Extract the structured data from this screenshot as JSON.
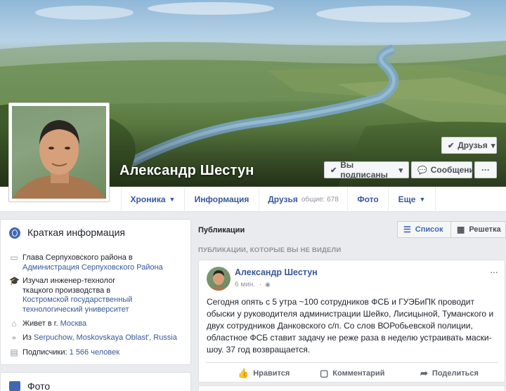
{
  "profile": {
    "name": "Александр Шестун",
    "buttons": {
      "friends": "Друзья",
      "subscribed": "Вы подписаны",
      "message": "Сообщение",
      "more": "···"
    }
  },
  "nav": {
    "tabs": [
      {
        "label": "Хроника",
        "caret": "▼"
      },
      {
        "label": "Информация"
      },
      {
        "label": "Друзья",
        "sub": "общие: 678"
      },
      {
        "label": "Фото"
      },
      {
        "label": "Еще",
        "caret": "▼"
      }
    ]
  },
  "intro": {
    "title": "Краткая информация",
    "rows": [
      {
        "icon": "briefcase-icon",
        "text": "Глава Серпуховского района в",
        "link": "Администрация Серпуховского Района"
      },
      {
        "icon": "graduation-cap-icon",
        "text": "Изучал инженер-технолог ткацкого производства в",
        "link": "Костромской государственный технологический университет"
      },
      {
        "icon": "home-icon",
        "text": "Живет в г.",
        "link": "Москва"
      },
      {
        "icon": "location-pin-icon",
        "text": "Из",
        "link": "Serpuchow, Moskovskaya Oblast', Russia"
      },
      {
        "icon": "subscribers-icon",
        "text": "Подписчики:",
        "link": "1 566 человек"
      }
    ]
  },
  "photos": {
    "title": "Фото"
  },
  "publications": {
    "title": "Публикации",
    "list_view": "Список",
    "grid_view": "Решетка",
    "unseen_label": "ПУБЛИКАЦИИ, КОТОРЫЕ ВЫ НЕ ВИДЕЛИ"
  },
  "post": {
    "author": "Александр Шестун",
    "time": "6 мин.",
    "text": "Сегодня опять с 5 утра ~100 сотрудников ФСБ и ГУЭБиПК проводит обыски у руководителя администрации Шейко, Лисицыной, Туманского и двух сотрудников Данковского с/п. Со слов ВОРобьевской полиции, областное ФСБ ставит задачу не реже раза в неделю устраивать маски-шоу. 37 год возвращается.",
    "actions": {
      "like": "Нравится",
      "comment": "Комментарий",
      "share": "Поделиться"
    }
  },
  "colors": {
    "link": "#385898",
    "brand": "#4267b2",
    "background": "#e9ebee"
  }
}
